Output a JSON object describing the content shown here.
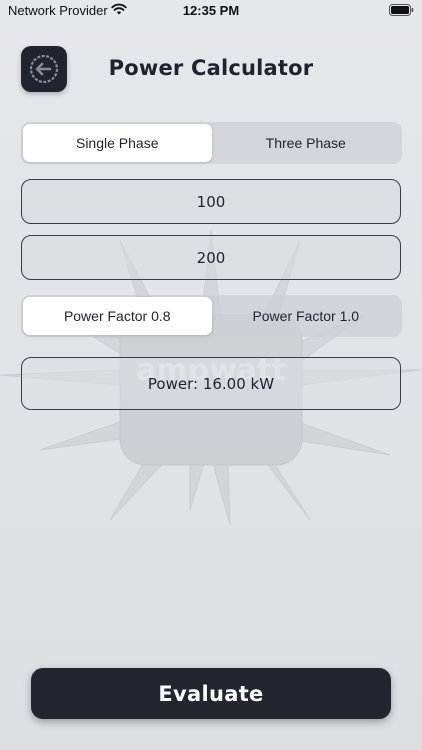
{
  "status_bar": {
    "provider": "Network Provider",
    "time": "12:35 PM"
  },
  "header": {
    "title": "Power Calculator",
    "back_icon": "back-arrow-circle-icon"
  },
  "phase_selector": {
    "options": [
      "Single Phase",
      "Three Phase"
    ],
    "selected": "Single Phase"
  },
  "inputs": {
    "field_1_value": "100",
    "field_2_value": "200"
  },
  "power_factor_selector": {
    "options": [
      "Power Factor 0.8",
      "Power Factor 1.0"
    ],
    "selected": "Power Factor 0.8"
  },
  "result": {
    "text": "Power: 16.00 kW"
  },
  "watermark": {
    "text": "ampwatt"
  },
  "actions": {
    "evaluate_label": "Evaluate"
  },
  "colors": {
    "primary_dark": "#23252f",
    "background": "#e2e3e6",
    "segment_active": "#ffffff"
  }
}
